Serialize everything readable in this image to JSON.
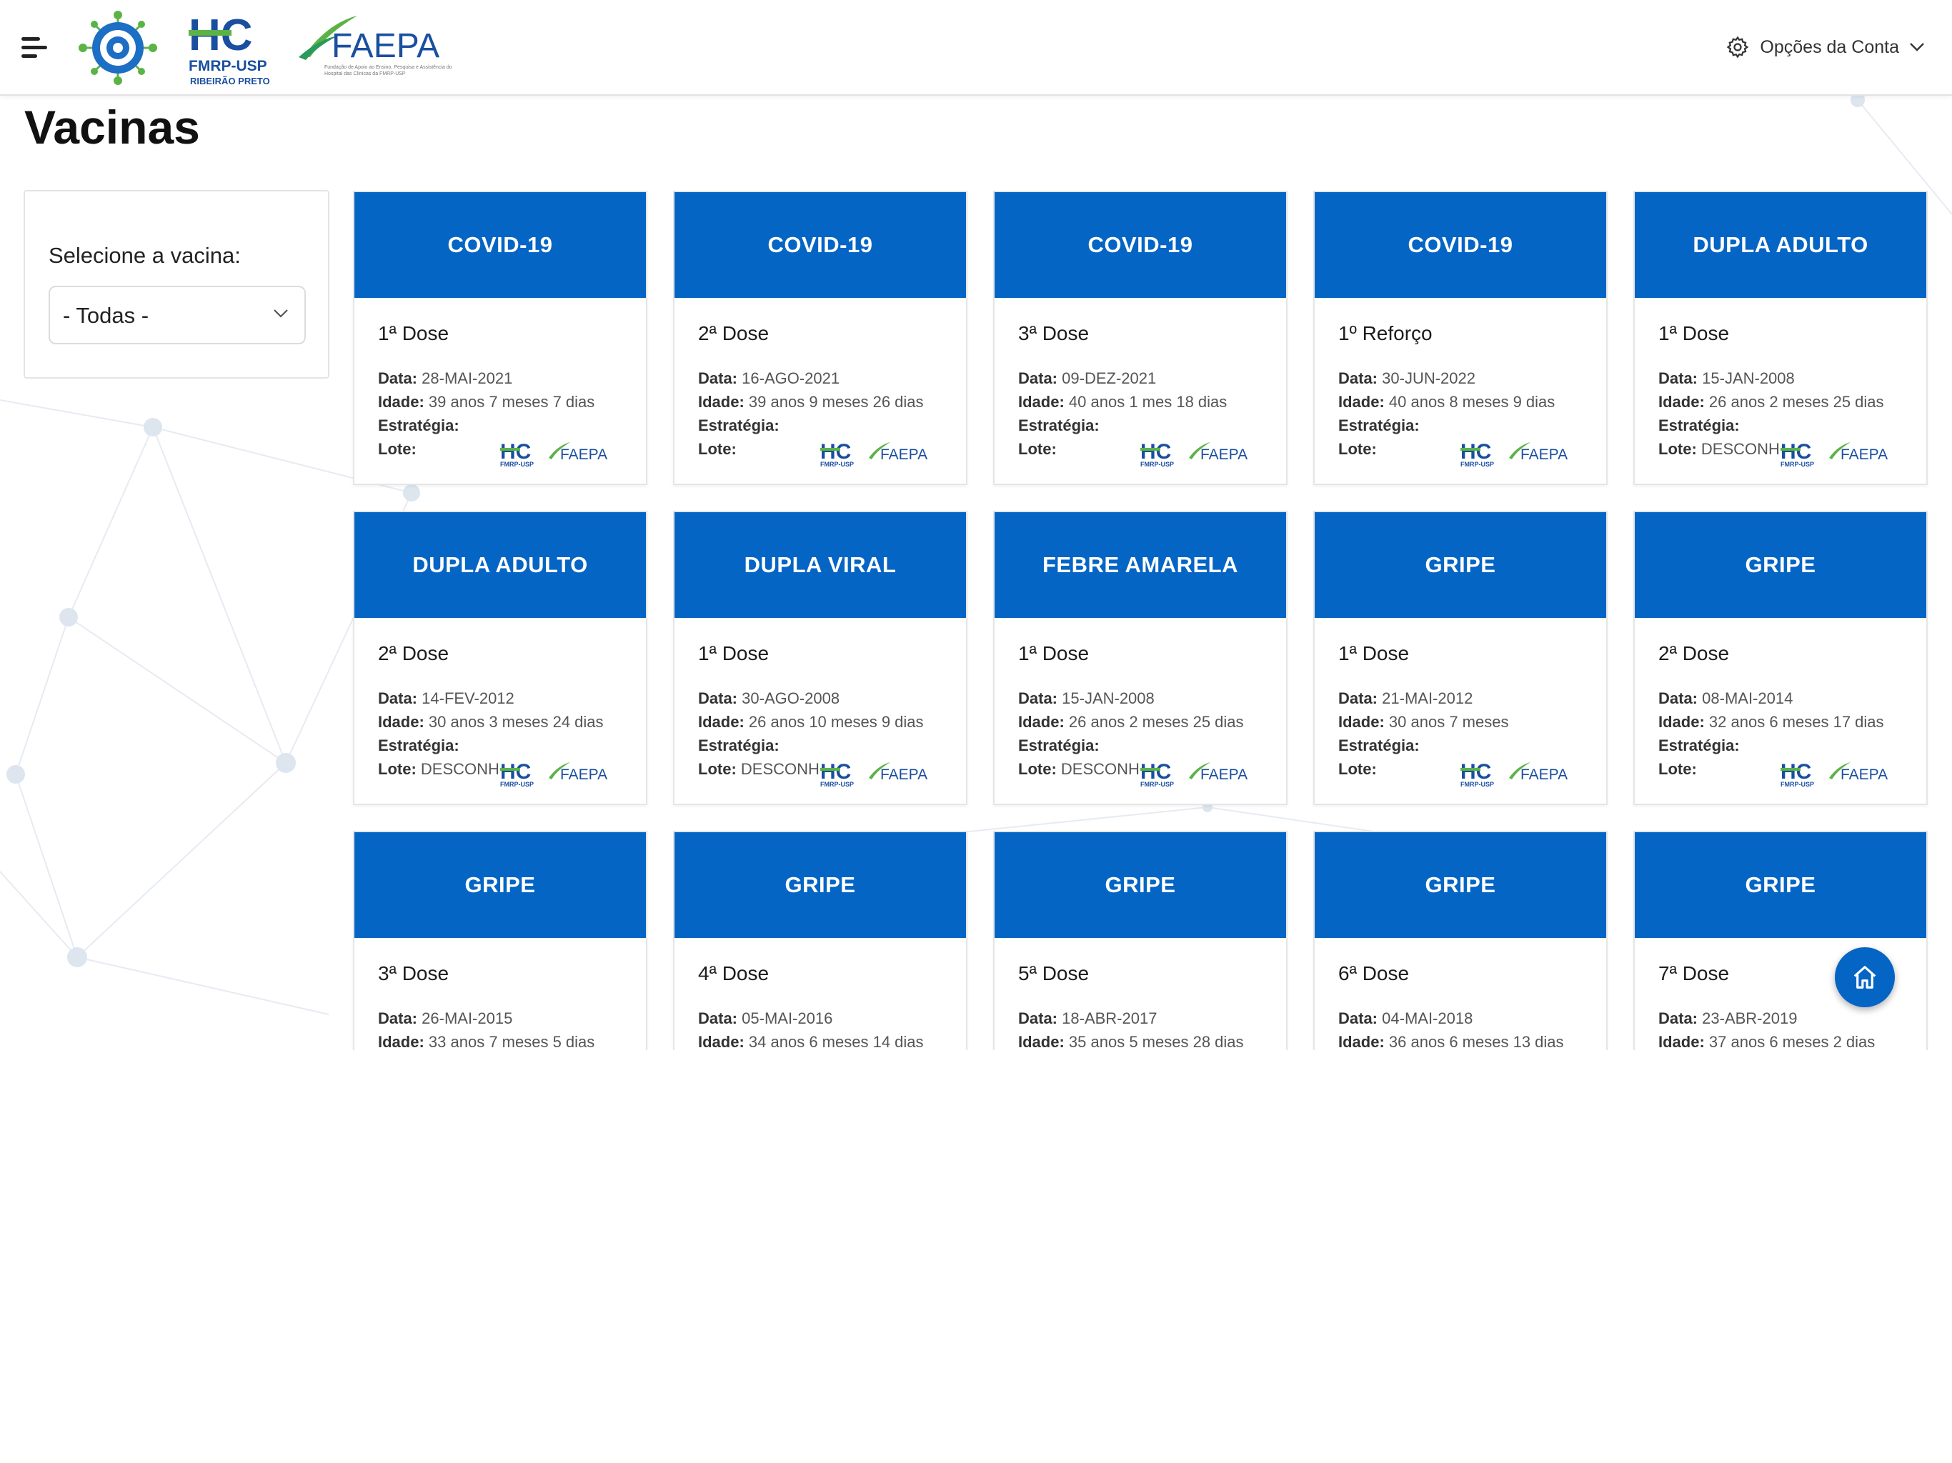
{
  "header": {
    "menu_icon": "hamburger-menu-icon",
    "logos": {
      "main": "vaccination-network-logo",
      "hc": {
        "mark": "HC",
        "line1": "FMRP-USP",
        "line2": "RIBEIRÃO PRETO"
      },
      "faepa": {
        "mark": "FAEPA",
        "tagline": "Fundação de Apoio ao Ensino, Pesquisa e Assistência do Hospital das Clínicas da FMRP-USP"
      }
    },
    "account_label": "Opções da Conta",
    "account_icon": "gear-icon"
  },
  "page": {
    "title": "Vacinas"
  },
  "filter": {
    "label": "Selecione a vacina:",
    "selected": "- Todas -"
  },
  "field_labels": {
    "data": "Data:",
    "idade": "Idade:",
    "estrategia": "Estratégia:",
    "lote": "Lote:"
  },
  "vaccines": [
    {
      "name": "COVID-19",
      "dose": "1ª Dose",
      "data": "28-MAI-2021",
      "idade": "39 anos 7 meses 7 dias",
      "estrategia": "",
      "lote": ""
    },
    {
      "name": "COVID-19",
      "dose": "2ª Dose",
      "data": "16-AGO-2021",
      "idade": "39 anos 9 meses 26 dias",
      "estrategia": "",
      "lote": ""
    },
    {
      "name": "COVID-19",
      "dose": "3ª Dose",
      "data": "09-DEZ-2021",
      "idade": "40 anos 1 mes 18 dias",
      "estrategia": "",
      "lote": ""
    },
    {
      "name": "COVID-19",
      "dose": "1º Reforço",
      "data": "30-JUN-2022",
      "idade": "40 anos 8 meses 9 dias",
      "estrategia": "",
      "lote": ""
    },
    {
      "name": "DUPLA ADULTO",
      "dose": "1ª Dose",
      "data": "15-JAN-2008",
      "idade": "26 anos 2 meses 25 dias",
      "estrategia": "",
      "lote": "DESCONHECIDO"
    },
    {
      "name": "DUPLA ADULTO",
      "dose": "2ª Dose",
      "data": "14-FEV-2012",
      "idade": "30 anos 3 meses 24 dias",
      "estrategia": "",
      "lote": "DESCONHECIDO"
    },
    {
      "name": "DUPLA VIRAL",
      "dose": "1ª Dose",
      "data": "30-AGO-2008",
      "idade": "26 anos 10 meses 9 dias",
      "estrategia": "",
      "lote": "DESCONHECIDO"
    },
    {
      "name": "FEBRE AMARELA",
      "dose": "1ª Dose",
      "data": "15-JAN-2008",
      "idade": "26 anos 2 meses 25 dias",
      "estrategia": "",
      "lote": "DESCONHECIDO"
    },
    {
      "name": "GRIPE",
      "dose": "1ª Dose",
      "data": "21-MAI-2012",
      "idade": "30 anos 7 meses",
      "estrategia": "",
      "lote": ""
    },
    {
      "name": "GRIPE",
      "dose": "2ª Dose",
      "data": "08-MAI-2014",
      "idade": "32 anos 6 meses 17 dias",
      "estrategia": "",
      "lote": ""
    },
    {
      "name": "GRIPE",
      "dose": "3ª Dose",
      "data": "26-MAI-2015",
      "idade": "33 anos 7 meses 5 dias",
      "estrategia": "",
      "lote": ""
    },
    {
      "name": "GRIPE",
      "dose": "4ª Dose",
      "data": "05-MAI-2016",
      "idade": "34 anos 6 meses 14 dias",
      "estrategia": "",
      "lote": ""
    },
    {
      "name": "GRIPE",
      "dose": "5ª Dose",
      "data": "18-ABR-2017",
      "idade": "35 anos 5 meses 28 dias",
      "estrategia": "",
      "lote": ""
    },
    {
      "name": "GRIPE",
      "dose": "6ª Dose",
      "data": "04-MAI-2018",
      "idade": "36 anos 6 meses 13 dias",
      "estrategia": "",
      "lote": ""
    },
    {
      "name": "GRIPE",
      "dose": "7ª Dose",
      "data": "23-ABR-2019",
      "idade": "37 anos 6 meses 2 dias",
      "estrategia": "",
      "lote": ""
    }
  ],
  "fab_icon": "home-icon",
  "colors": {
    "primary": "#0565c5",
    "card_title_text": "#ffffff",
    "header_background": "#ffffff",
    "logo_green": "#5bb346",
    "logo_blue": "#1a4fa0"
  }
}
